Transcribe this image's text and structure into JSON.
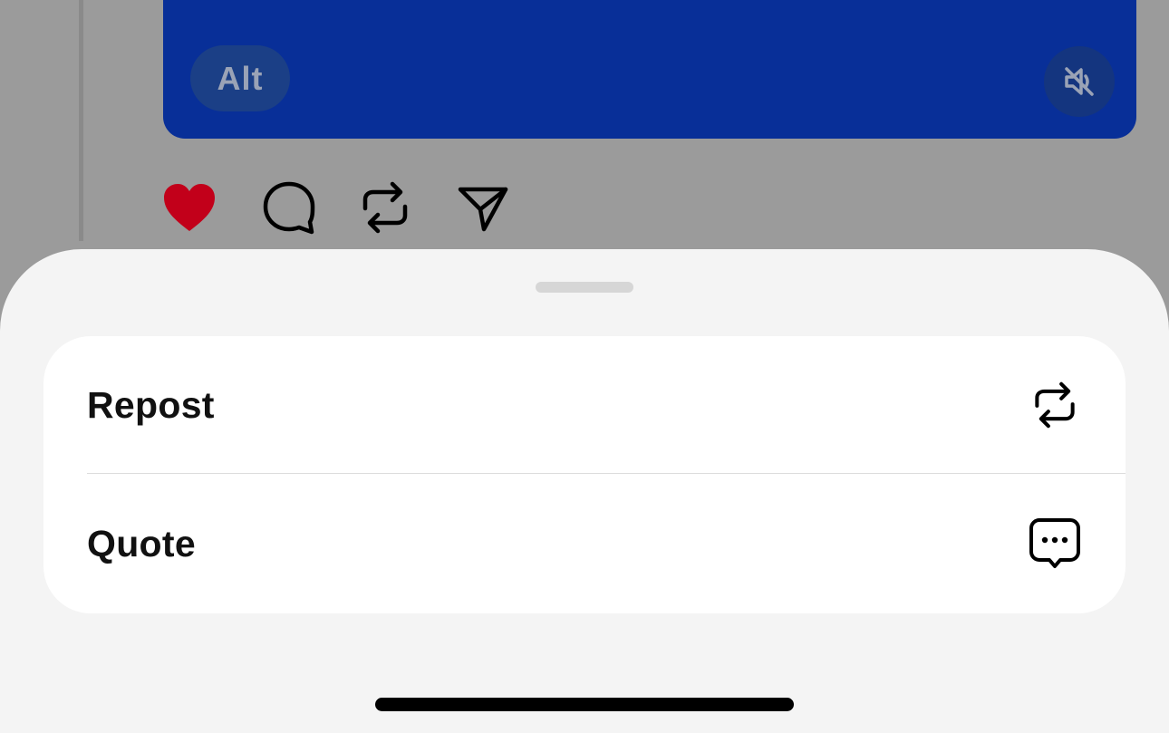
{
  "media": {
    "alt_label": "Alt",
    "background": "#082f98",
    "mute_icon": "speaker-muted-icon"
  },
  "post_actions": {
    "like_icon": "heart-icon",
    "like_state": "liked",
    "like_color": "#c2001a",
    "reply_icon": "comment-bubble-icon",
    "repost_icon": "repost-icon",
    "share_icon": "send-icon"
  },
  "sheet": {
    "options": [
      {
        "label": "Repost",
        "icon": "repost-icon"
      },
      {
        "label": "Quote",
        "icon": "quote-bubble-icon"
      }
    ]
  }
}
